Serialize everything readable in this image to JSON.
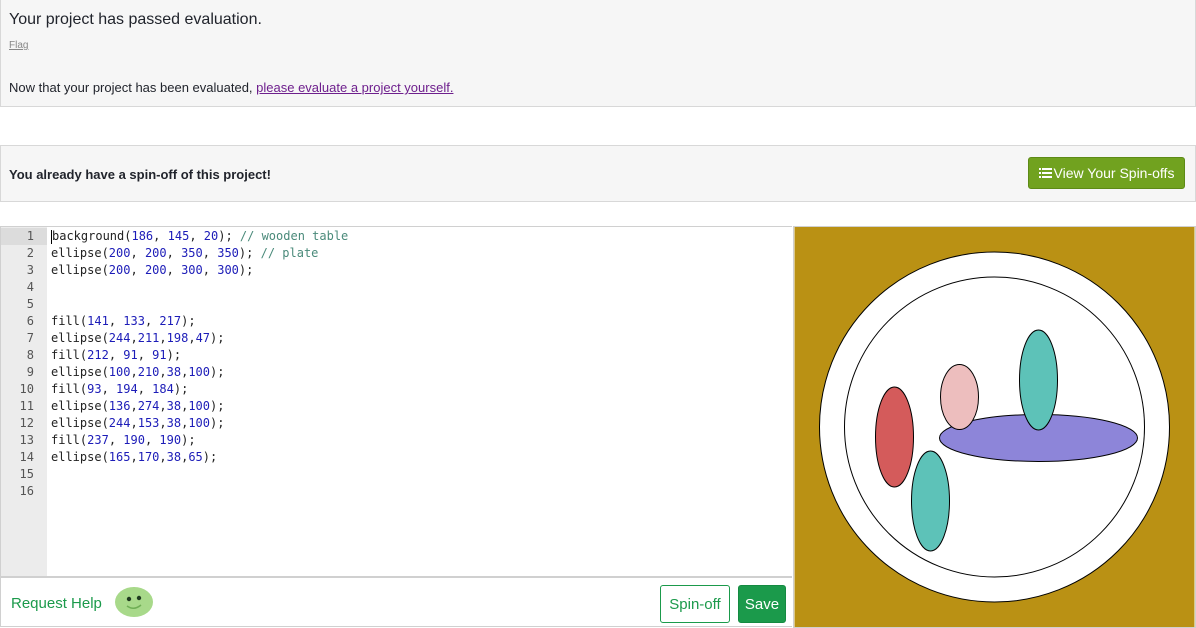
{
  "evaluation": {
    "title": "Your project has passed evaluation.",
    "flag_label": "Flag",
    "message_prefix": "Now that your project has been evaluated, ",
    "message_link": "please evaluate a project yourself."
  },
  "spinoff": {
    "message": "You already have a spin-off of this project!",
    "view_button_label": "View Your Spin-offs",
    "view_button_icon": "list-icon"
  },
  "editor": {
    "lines": [
      {
        "n": "1",
        "tokens": [
          [
            "t",
            "background("
          ],
          [
            "n",
            "186"
          ],
          [
            "t",
            ", "
          ],
          [
            "n",
            "145"
          ],
          [
            "t",
            ", "
          ],
          [
            "n",
            "20"
          ],
          [
            "t",
            "); "
          ],
          [
            "c",
            "// wooden table"
          ]
        ]
      },
      {
        "n": "2",
        "tokens": [
          [
            "t",
            "ellipse("
          ],
          [
            "n",
            "200"
          ],
          [
            "t",
            ", "
          ],
          [
            "n",
            "200"
          ],
          [
            "t",
            ", "
          ],
          [
            "n",
            "350"
          ],
          [
            "t",
            ", "
          ],
          [
            "n",
            "350"
          ],
          [
            "t",
            "); "
          ],
          [
            "c",
            "// plate"
          ]
        ]
      },
      {
        "n": "3",
        "tokens": [
          [
            "t",
            "ellipse("
          ],
          [
            "n",
            "200"
          ],
          [
            "t",
            ", "
          ],
          [
            "n",
            "200"
          ],
          [
            "t",
            ", "
          ],
          [
            "n",
            "300"
          ],
          [
            "t",
            ", "
          ],
          [
            "n",
            "300"
          ],
          [
            "t",
            ");"
          ]
        ]
      },
      {
        "n": "4",
        "tokens": []
      },
      {
        "n": "5",
        "tokens": []
      },
      {
        "n": "6",
        "tokens": [
          [
            "t",
            "fill("
          ],
          [
            "n",
            "141"
          ],
          [
            "t",
            ", "
          ],
          [
            "n",
            "133"
          ],
          [
            "t",
            ", "
          ],
          [
            "n",
            "217"
          ],
          [
            "t",
            ");"
          ]
        ]
      },
      {
        "n": "7",
        "tokens": [
          [
            "t",
            "ellipse("
          ],
          [
            "n",
            "244"
          ],
          [
            "t",
            ","
          ],
          [
            "n",
            "211"
          ],
          [
            "t",
            ","
          ],
          [
            "n",
            "198"
          ],
          [
            "t",
            ","
          ],
          [
            "n",
            "47"
          ],
          [
            "t",
            ");"
          ]
        ]
      },
      {
        "n": "8",
        "tokens": [
          [
            "t",
            "fill("
          ],
          [
            "n",
            "212"
          ],
          [
            "t",
            ", "
          ],
          [
            "n",
            "91"
          ],
          [
            "t",
            ", "
          ],
          [
            "n",
            "91"
          ],
          [
            "t",
            ");"
          ]
        ]
      },
      {
        "n": "9",
        "tokens": [
          [
            "t",
            "ellipse("
          ],
          [
            "n",
            "100"
          ],
          [
            "t",
            ","
          ],
          [
            "n",
            "210"
          ],
          [
            "t",
            ","
          ],
          [
            "n",
            "38"
          ],
          [
            "t",
            ","
          ],
          [
            "n",
            "100"
          ],
          [
            "t",
            ");"
          ]
        ]
      },
      {
        "n": "10",
        "tokens": [
          [
            "t",
            "fill("
          ],
          [
            "n",
            "93"
          ],
          [
            "t",
            ", "
          ],
          [
            "n",
            "194"
          ],
          [
            "t",
            ", "
          ],
          [
            "n",
            "184"
          ],
          [
            "t",
            ");"
          ]
        ]
      },
      {
        "n": "11",
        "tokens": [
          [
            "t",
            "ellipse("
          ],
          [
            "n",
            "136"
          ],
          [
            "t",
            ","
          ],
          [
            "n",
            "274"
          ],
          [
            "t",
            ","
          ],
          [
            "n",
            "38"
          ],
          [
            "t",
            ","
          ],
          [
            "n",
            "100"
          ],
          [
            "t",
            ");"
          ]
        ]
      },
      {
        "n": "12",
        "tokens": [
          [
            "t",
            "ellipse("
          ],
          [
            "n",
            "244"
          ],
          [
            "t",
            ","
          ],
          [
            "n",
            "153"
          ],
          [
            "t",
            ","
          ],
          [
            "n",
            "38"
          ],
          [
            "t",
            ","
          ],
          [
            "n",
            "100"
          ],
          [
            "t",
            ");"
          ]
        ]
      },
      {
        "n": "13",
        "tokens": [
          [
            "t",
            "fill("
          ],
          [
            "n",
            "237"
          ],
          [
            "t",
            ", "
          ],
          [
            "n",
            "190"
          ],
          [
            "t",
            ", "
          ],
          [
            "n",
            "190"
          ],
          [
            "t",
            ");"
          ]
        ]
      },
      {
        "n": "14",
        "tokens": [
          [
            "t",
            "ellipse("
          ],
          [
            "n",
            "165"
          ],
          [
            "t",
            ","
          ],
          [
            "n",
            "170"
          ],
          [
            "t",
            ","
          ],
          [
            "n",
            "38"
          ],
          [
            "t",
            ","
          ],
          [
            "n",
            "65"
          ],
          [
            "t",
            ");"
          ]
        ]
      },
      {
        "n": "15",
        "tokens": []
      },
      {
        "n": "16",
        "tokens": []
      }
    ]
  },
  "bottom_bar": {
    "request_help_label": "Request Help",
    "avatar_icon": "green-avatar-icon",
    "spinoff_button_label": "Spin-off",
    "save_button_label": "Save"
  },
  "colors": {
    "table": "#ba9114",
    "plate": "#ffffff",
    "purple": "#8d85d9",
    "red": "#d45b5b",
    "teal": "#5dc2b8",
    "pink": "#edbebe",
    "accent_green": "#1b9a4b",
    "button_green": "#71a21f"
  }
}
